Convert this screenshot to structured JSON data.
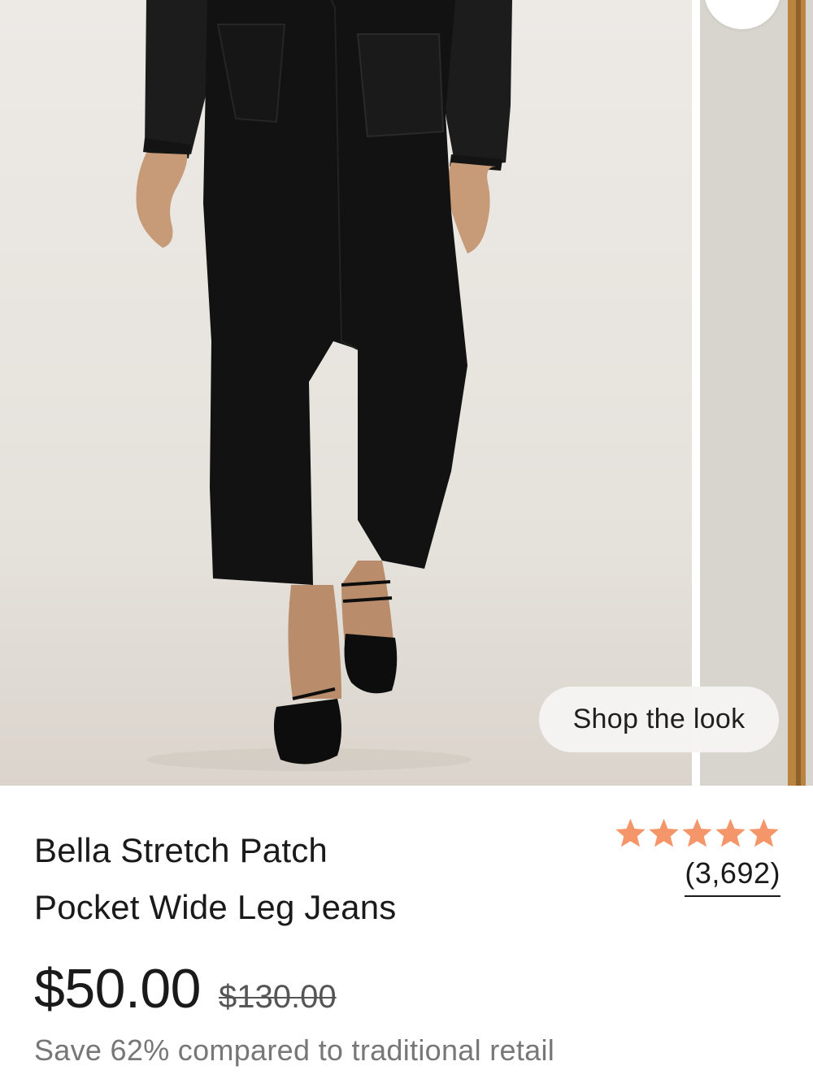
{
  "product": {
    "title_line1": "Bella Stretch Patch",
    "title_line2": "Pocket Wide Leg Jeans",
    "price": "$50.00",
    "original_price": "$130.00",
    "savings_text": "Save 62% compared to traditional retail"
  },
  "rating": {
    "stars": 5,
    "review_count": "(3,692)"
  },
  "gallery": {
    "shop_the_look_label": "Shop the look",
    "favorite_icon": "heart-icon"
  },
  "colors": {
    "star": "#F5956A",
    "text": "#1a1a1a",
    "muted": "#777777",
    "photo_background": "#E7E3DD"
  }
}
